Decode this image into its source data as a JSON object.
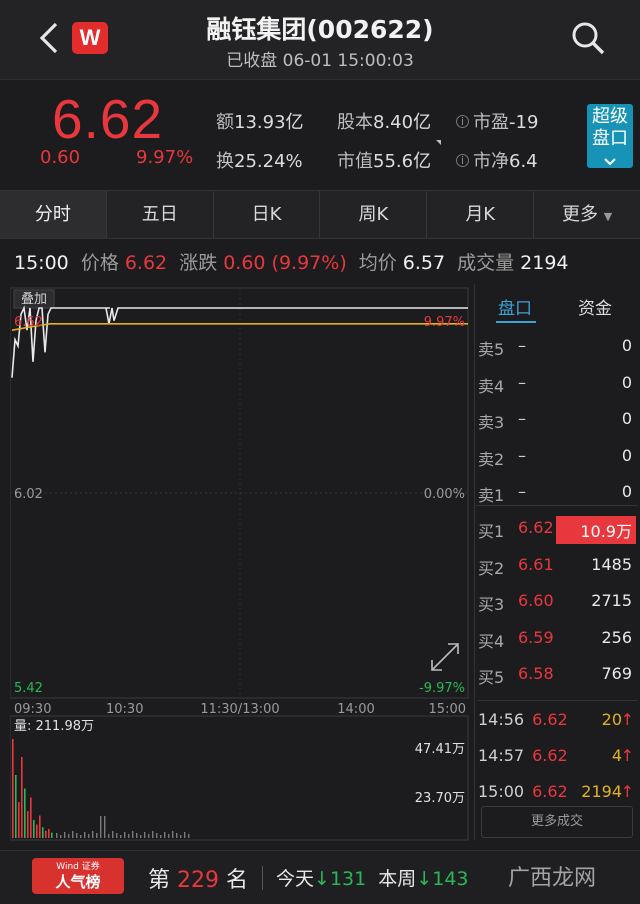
{
  "header": {
    "title": "融钰集团(002622)",
    "status": "已收盘 06-01 15:00:03",
    "logo_text": "W"
  },
  "quote": {
    "price": "6.62",
    "change": "0.60",
    "change_pct": "9.97%",
    "amount_label": "额",
    "amount": "13.93亿",
    "turnover_label": "换",
    "turnover": "25.24%",
    "shares_label": "股本",
    "shares": "8.40亿",
    "mktcap_label": "市值",
    "mktcap": "55.6亿",
    "pe_label": "市盈",
    "pe": "-19",
    "pb_label": "市净",
    "pb": "6.4",
    "super_btn_line1": "超级",
    "super_btn_line2": "盘口"
  },
  "tabs": [
    "分时",
    "五日",
    "日K",
    "周K",
    "月K",
    "更多"
  ],
  "info_row": {
    "time": "15:00",
    "price_label": "价格",
    "price": "6.62",
    "chg_label": "涨跌",
    "chg": "0.60 (9.97%)",
    "avg_label": "均价",
    "avg": "6.57",
    "vol_label": "成交量",
    "vol": "2194"
  },
  "chart": {
    "overlay_btn": "叠加",
    "y_top": "6.62",
    "y_mid": "6.02",
    "y_bot": "5.42",
    "pct_top": "9.97%",
    "pct_mid": "0.00%",
    "pct_bot": "-9.97%",
    "x_labels": [
      "09:30",
      "10:30",
      "11:30/13:00",
      "14:00",
      "15:00"
    ],
    "vol_label": "量: 211.98万",
    "vol_top": "47.41万",
    "vol_mid": "23.70万"
  },
  "chart_data": {
    "type": "line",
    "xlabel": "",
    "ylabel": "",
    "x": [
      "09:30",
      "10:30",
      "11:30/13:00",
      "14:00",
      "15:00"
    ],
    "ylim": [
      5.42,
      6.62
    ],
    "series": [
      {
        "values": [
          6.62,
          6.62,
          6.62,
          6.62,
          6.62
        ]
      },
      {
        "values": [
          6.55,
          6.57,
          6.57,
          6.57,
          6.57
        ]
      }
    ],
    "volume_max": "47.41万"
  },
  "right_panel": {
    "tab_orderbook": "盘口",
    "tab_funds": "资金",
    "asks": [
      {
        "level": "卖5",
        "price": "–",
        "vol": "0"
      },
      {
        "level": "卖4",
        "price": "–",
        "vol": "0"
      },
      {
        "level": "卖3",
        "price": "–",
        "vol": "0"
      },
      {
        "level": "卖2",
        "price": "–",
        "vol": "0"
      },
      {
        "level": "卖1",
        "price": "–",
        "vol": "0"
      }
    ],
    "bids": [
      {
        "level": "买1",
        "price": "6.62",
        "vol": "10.9万"
      },
      {
        "level": "买2",
        "price": "6.61",
        "vol": "1485"
      },
      {
        "level": "买3",
        "price": "6.60",
        "vol": "2715"
      },
      {
        "level": "买4",
        "price": "6.59",
        "vol": "256"
      },
      {
        "level": "买5",
        "price": "6.58",
        "vol": "769"
      }
    ],
    "trades": [
      {
        "time": "14:56",
        "price": "6.62",
        "vol": "20"
      },
      {
        "time": "14:57",
        "price": "6.62",
        "vol": "4"
      },
      {
        "time": "15:00",
        "price": "6.62",
        "vol": "2194"
      }
    ],
    "more_trades": "更多成交"
  },
  "bottom": {
    "badge_top": "Wind 证券",
    "badge_main": "人气榜",
    "rank_prefix": "第",
    "rank": "229",
    "rank_suffix": "名",
    "today_label": "今天",
    "today": "131",
    "week_label": "本周",
    "week": "143",
    "watermark": "广西龙网"
  },
  "colors": {
    "up": "#e8373d",
    "down": "#27b857",
    "accent": "#1693b6",
    "avg_line": "#e3b11e"
  }
}
